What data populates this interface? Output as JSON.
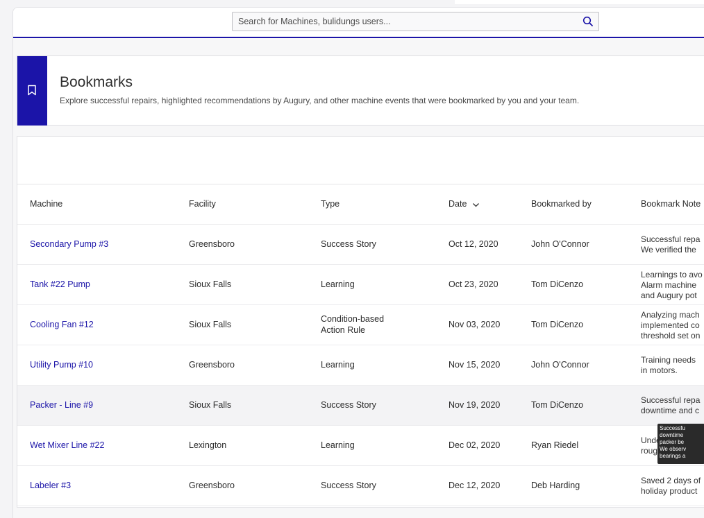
{
  "search": {
    "placeholder": "Search for Machines, bulidungs users..."
  },
  "page": {
    "title": "Bookmarks",
    "subtitle": "Explore successful repairs, highlighted recommendations by Augury, and other machine events that were bookmarked by you and your team."
  },
  "table": {
    "columns": {
      "machine": "Machine",
      "facility": "Facility",
      "type": "Type",
      "date": "Date",
      "bookmarked_by": "Bookmarked by",
      "note": "Bookmark Note"
    },
    "rows": [
      {
        "machine": "Secondary Pump #3",
        "facility": "Greensboro",
        "type": "Success Story",
        "date": "Oct 12, 2020",
        "by": "John O'Connor",
        "note": "Successful repa\nWe verified the"
      },
      {
        "machine": "Tank #22 Pump",
        "facility": "Sioux Falls",
        "type": "Learning",
        "date": "Oct 23, 2020",
        "by": "Tom DiCenzo",
        "note": "Learnings to avo\nAlarm machine\nand Augury pot"
      },
      {
        "machine": "Cooling Fan #12",
        "facility": "Sioux Falls",
        "type": "Condition-based\nAction Rule",
        "date": "Nov 03, 2020",
        "by": "Tom DiCenzo",
        "note": "Analyzing mach\nimplemented co\nthreshold set on"
      },
      {
        "machine": "Utility Pump #10",
        "facility": "Greensboro",
        "type": "Learning",
        "date": "Nov 15, 2020",
        "by": "John O'Connor",
        "note": "Training needs\nin motors."
      },
      {
        "machine": "Packer -  Line #9",
        "facility": "Sioux Falls",
        "type": "Success Story",
        "date": "Nov 19, 2020",
        "by": "Tom DiCenzo",
        "note": "Successful repa\ndowntime and c"
      },
      {
        "machine": "Wet Mixer Line #22",
        "facility": "Lexington",
        "type": "Learning",
        "date": "Dec 02, 2020",
        "by": "Ryan Riedel",
        "note": "Underl\nroughn"
      },
      {
        "machine": "Labeler #3",
        "facility": "Greensboro",
        "type": "Success Story",
        "date": "Dec 12, 2020",
        "by": "Deb Harding",
        "note": "Saved 2 days of\nholiday product"
      }
    ]
  },
  "tooltip": {
    "text": "Successfu\ndowntime\npacker be\nWe observ\nbearings a"
  },
  "colors": {
    "accent": "#1b14a8",
    "link": "#1b14a8",
    "row_highlight": "#f3f3f5"
  },
  "icons": {
    "search": "search-icon",
    "bookmark": "bookmark-icon",
    "sort": "chevron-down-icon"
  }
}
